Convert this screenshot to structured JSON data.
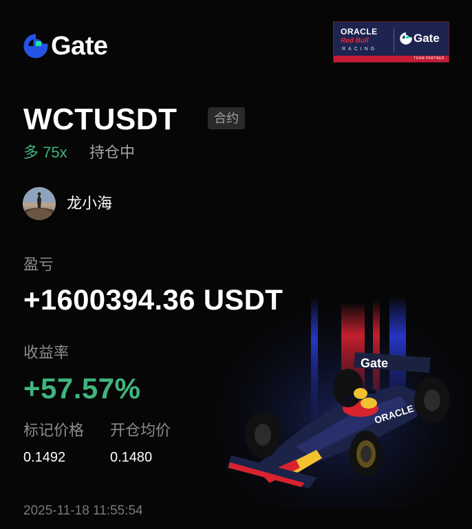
{
  "brand": {
    "name": "Gate",
    "icon": "gate-logo-icon",
    "accent": "#2354e6",
    "accent_secondary": "#17e6a1"
  },
  "partner_badge": {
    "sponsor": "ORACLE",
    "team": "Red Bull",
    "racing": "RACING",
    "partner_brand": "Gate",
    "footer": "TEAM PARTNER"
  },
  "position": {
    "symbol": "WCTUSDT",
    "type_tag": "合约",
    "direction": "多 75x",
    "status": "持仓中",
    "direction_color": "#3fb57e"
  },
  "user": {
    "name": "龙小海",
    "avatar": "avatar-icon"
  },
  "pnl": {
    "label": "盈亏",
    "value": "+1600394.36 USDT"
  },
  "roi": {
    "label": "收益率",
    "value": "+57.57%",
    "color": "#3fb57e"
  },
  "mark_price": {
    "label": "标记价格",
    "value": "0.1492"
  },
  "entry_price": {
    "label": "开仓均价",
    "value": "0.1480"
  },
  "timestamp": "2025-11-18 11:55:54",
  "illustration": {
    "icon": "race-car-icon"
  }
}
